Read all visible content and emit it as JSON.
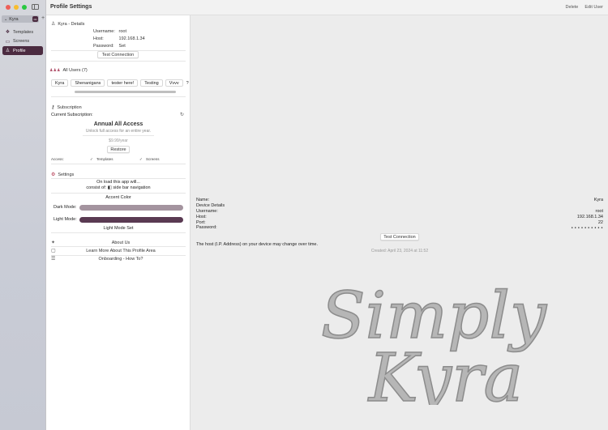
{
  "window": {
    "title": "Profile Settings",
    "actions": [
      "Delete",
      "Edit User"
    ],
    "traffic_colors": [
      "#ee5f58",
      "#f8bd2e",
      "#29c840"
    ]
  },
  "sidebar": {
    "user_picker": {
      "value": "Kyra",
      "chevron": "chevron-down-icon",
      "menu": "ellipsis-icon"
    },
    "add_label": "+",
    "items": [
      {
        "label": "Templates",
        "icon": "templates-icon"
      },
      {
        "label": "Screens",
        "icon": "screens-icon"
      },
      {
        "label": "Profile",
        "icon": "person-icon",
        "active": true
      }
    ],
    "accent": "#4b2b40"
  },
  "profile": {
    "details_title": "Kyra - Details",
    "fields": [
      {
        "key": "Username:",
        "value": "root"
      },
      {
        "key": "Host:",
        "value": "192.168.1.34"
      },
      {
        "key": "Password:",
        "value": "Set"
      }
    ],
    "test_connection": "Test Connection",
    "all_users_title": "All Users (7)",
    "users": [
      "Kyra",
      "Shenanigans",
      "tester here!",
      "Testing",
      "Vvvv",
      "?"
    ],
    "subscription_title": "Subscription",
    "current_subscription": "Current Subscription:",
    "plan_name": "Annual All Access",
    "plan_desc": "Unlock full access for an entire year.",
    "plan_price": "$9.99/year",
    "restore": "Restore",
    "access_label": "Access:",
    "access_items": [
      "Templates",
      "Screens"
    ],
    "settings_title": "Settings",
    "on_load_line1": "On load this app will...",
    "on_load_prefix": "consist of:",
    "on_load_value": "side bar navigation",
    "accent_color_title": "Accent Color",
    "dark_mode_label": "Dark Mode:",
    "light_mode_label": "Light Mode:",
    "dark_mode_color": "#a4949f",
    "light_mode_color": "#5a3a52",
    "light_mode_set": "Light Mode Set",
    "links": [
      {
        "label": "About Us",
        "icon": "sparkles-icon"
      },
      {
        "label": "Learn More About This Profile Area",
        "icon": "chat-bubble-icon"
      },
      {
        "label": "Onboarding - How To?",
        "icon": "list-icon"
      }
    ]
  },
  "detail": {
    "name_label": "Name:",
    "name_value": "Kyra",
    "device_details": "Device Details",
    "rows": [
      {
        "label": "Username:",
        "value": "root"
      },
      {
        "label": "Host:",
        "value": "192.168.1.34"
      },
      {
        "label": "Port:",
        "value": "22"
      },
      {
        "label": "Password:",
        "value": "● ● ● ● ● ● ● ● ● ●"
      }
    ],
    "test_connection": "Test Connection",
    "note": "The host (I.P. Address) on your device may change over time.",
    "created": "Created: April 23, 2024 at 11:52"
  },
  "watermark": {
    "line1": "Simply",
    "line2": "Kyra"
  }
}
